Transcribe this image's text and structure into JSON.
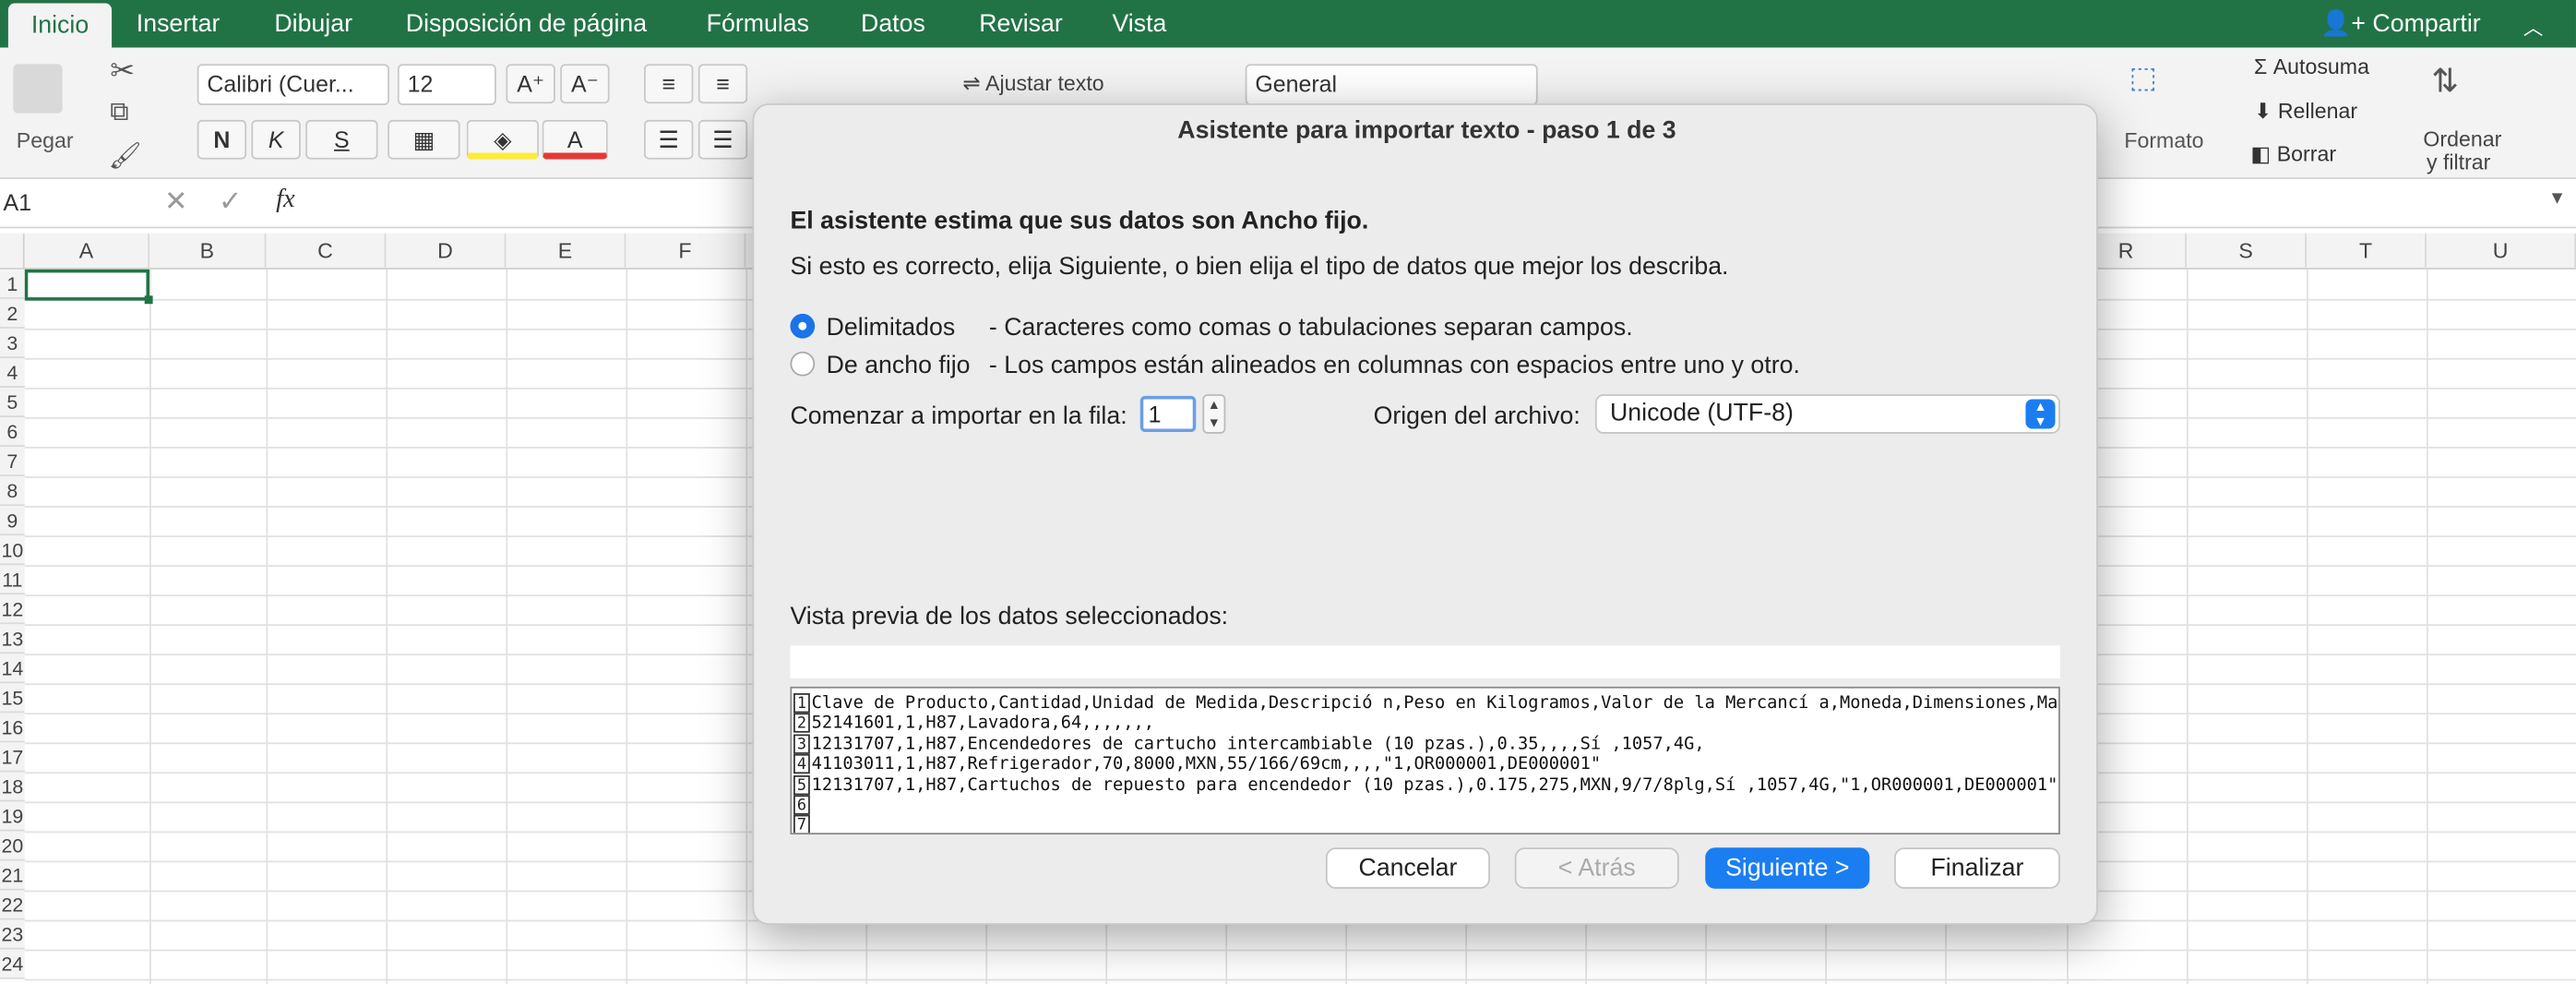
{
  "ribbon_tabs": [
    "Inicio",
    "Insertar",
    "Dibujar",
    "Disposición de página",
    "Fórmulas",
    "Datos",
    "Revisar",
    "Vista"
  ],
  "share_label": "Compartir",
  "ribbon": {
    "paste_label": "Pegar",
    "font_name": "Calibri (Cuer...",
    "font_size": "12",
    "bold": "N",
    "italic": "K",
    "underline": "S",
    "wrap_text": "Ajustar texto",
    "number_format": "General",
    "format_label": "Formato",
    "format_partial": "r",
    "autosum": "Autosuma",
    "fill": "Rellenar",
    "clear": "Borrar",
    "sort_filter_1": "Ordenar",
    "sort_filter_2": "y filtrar"
  },
  "formula_bar": {
    "cell_ref": "A1",
    "fx": "fx",
    "value": ""
  },
  "columns": [
    "A",
    "B",
    "C",
    "D",
    "E",
    "F",
    "R",
    "S",
    "T",
    "U"
  ],
  "rows": [
    "1",
    "2",
    "3",
    "4",
    "5",
    "6",
    "7",
    "8",
    "9",
    "10",
    "11",
    "12",
    "13",
    "14",
    "15",
    "16",
    "17",
    "18",
    "19",
    "20",
    "21",
    "22",
    "23",
    "24"
  ],
  "dialog": {
    "title": "Asistente para importar texto - paso 1 de 3",
    "heading": "El asistente estima que sus datos son Ancho fijo.",
    "subtext": "Si esto es correcto, elija Siguiente, o bien elija el tipo de datos que mejor los describa.",
    "option_delimited": "Delimitados",
    "option_delimited_desc": "- Caracteres como comas o tabulaciones separan campos.",
    "option_fixed": "De ancho fijo",
    "option_fixed_desc": "- Los campos están alineados en columnas con espacios entre uno y otro.",
    "start_row_label": "Comenzar a importar en la fila:",
    "start_row_value": "1",
    "origin_label": "Origen del archivo:",
    "origin_value": "Unicode (UTF-8)",
    "preview_label": "Vista previa de los datos seleccionados:",
    "preview_lines": [
      {
        "n": "1",
        "text": "Clave de Producto,Cantidad,Unidad de Medida,Descripció n,Peso en Kilogramos,Valor de la Mercancí a,Moneda,Dimensiones,Material Peligroso"
      },
      {
        "n": "2",
        "text": "52141601,1,H87,Lavadora,64,,,,,,,"
      },
      {
        "n": "3",
        "text": "12131707,1,H87,Encendedores de cartucho intercambiable (10 pzas.),0.35,,,,Sí ,1057,4G,"
      },
      {
        "n": "4",
        "text": "41103011,1,H87,Refrigerador,70,8000,MXN,55/166/69cm,,,,\"1,OR000001,DE000001\""
      },
      {
        "n": "5",
        "text": "12131707,1,H87,Cartuchos de repuesto para encendedor (10 pzas.),0.175,275,MXN,9/7/8plg,Sí ,1057,4G,\"1,OR000001,DE000001\""
      },
      {
        "n": "6",
        "text": ""
      },
      {
        "n": "7",
        "text": ""
      }
    ],
    "btn_cancel": "Cancelar",
    "btn_back": "< Atrás",
    "btn_next": "Siguiente >",
    "btn_finish": "Finalizar"
  }
}
